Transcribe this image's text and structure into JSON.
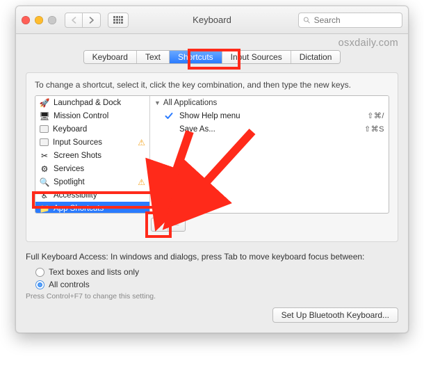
{
  "window": {
    "title": "Keyboard",
    "search_placeholder": "Search"
  },
  "watermark": "osxdaily.com",
  "tabs": [
    {
      "label": "Keyboard"
    },
    {
      "label": "Text"
    },
    {
      "label": "Shortcuts",
      "selected": true
    },
    {
      "label": "Input Sources"
    },
    {
      "label": "Dictation"
    }
  ],
  "instruction": "To change a shortcut, select it, click the key combination, and then type the new keys.",
  "categories": [
    {
      "icon": "launchpad-icon",
      "label": "Launchpad & Dock"
    },
    {
      "icon": "mission-control-icon",
      "label": "Mission Control"
    },
    {
      "icon": "keyboard-icon",
      "label": "Keyboard"
    },
    {
      "icon": "input-sources-icon",
      "label": "Input Sources",
      "warning": true
    },
    {
      "icon": "screenshots-icon",
      "label": "Screen Shots"
    },
    {
      "icon": "services-icon",
      "label": "Services"
    },
    {
      "icon": "spotlight-icon",
      "label": "Spotlight",
      "warning": true
    },
    {
      "icon": "accessibility-icon",
      "label": "Accessibility"
    },
    {
      "icon": "app-shortcuts-icon",
      "label": "App Shortcuts",
      "selected": true
    }
  ],
  "group_header": "All Applications",
  "shortcuts": [
    {
      "checked": true,
      "label": "Show Help menu",
      "keys": "⇧⌘/"
    },
    {
      "checked": false,
      "label": "Save As...",
      "keys": "⇧⌘S"
    }
  ],
  "add_label": "+",
  "remove_label": "−",
  "fka": {
    "intro": "Full Keyboard Access: In windows and dialogs, press Tab to move keyboard focus between:",
    "opt1": "Text boxes and lists only",
    "opt2": "All controls",
    "hint": "Press Control+F7 to change this setting."
  },
  "footer_button": "Set Up Bluetooth Keyboard..."
}
